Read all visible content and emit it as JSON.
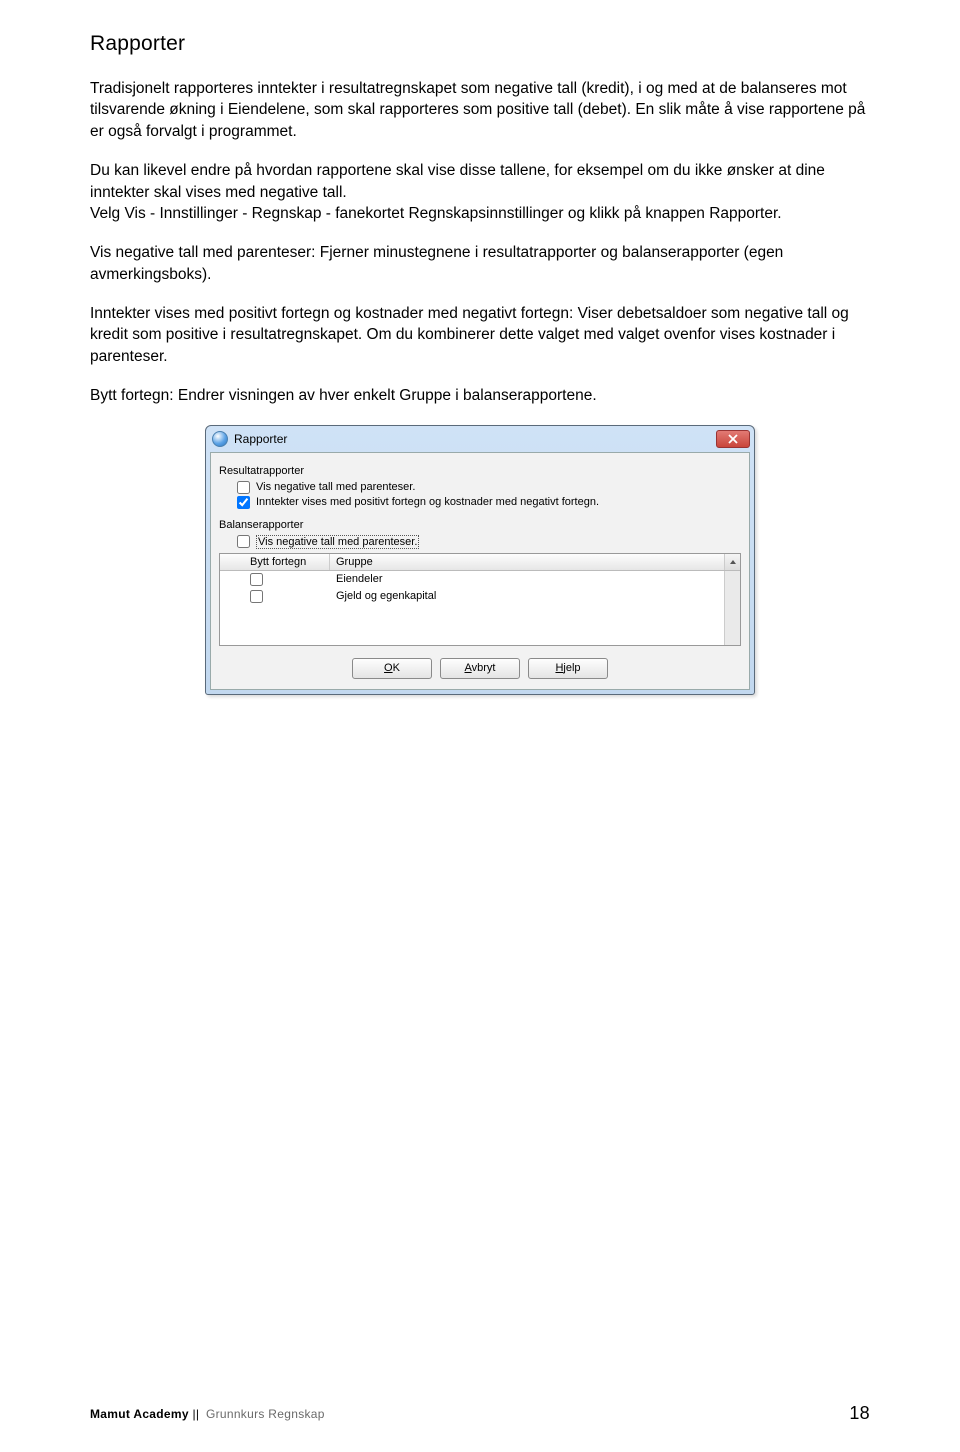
{
  "heading": "Rapporter",
  "paragraphs": {
    "p1": "Tradisjonelt rapporteres inntekter i resultatregnskapet som negative tall (kredit), i og med at de balanseres mot tilsvarende økning i Eiendelene, som skal rapporteres som positive tall (debet). En slik måte å vise rapportene på er også forvalgt i programmet.",
    "p2a": "Du kan likevel endre på hvordan rapportene skal vise disse tallene, for eksempel om du ikke ønsker at dine inntekter skal vises med negative tall.",
    "p2b": "Velg Vis - Innstillinger - Regnskap - fanekortet Regnskapsinnstillinger og klikk på knappen Rapporter.",
    "p3": "Vis negative tall med parenteser: Fjerner minustegnene i resultatrapporter og balanserapporter (egen avmerkingsboks).",
    "p4": "Inntekter vises med positivt fortegn og kostnader med negativt fortegn: Viser debetsaldoer som negative tall og kredit som positive i resultatregnskapet. Om du kombinerer dette valget med valget ovenfor vises kostnader i parenteser.",
    "p5": "Bytt fortegn: Endrer visningen av hver enkelt Gruppe i balanserapportene."
  },
  "dialog": {
    "title": "Rapporter",
    "group1": "Resultatrapporter",
    "check1": "Vis negative tall med parenteser.",
    "check2": "Inntekter vises med positivt fortegn og kostnader med negativt fortegn.",
    "group2": "Balanserapporter",
    "check3": "Vis negative tall med parenteser.",
    "table": {
      "col1": "Bytt fortegn",
      "col2": "Gruppe",
      "rows": [
        "Eiendeler",
        "Gjeld og egenkapital"
      ]
    },
    "buttons": {
      "ok": "OK",
      "cancel": "Avbryt",
      "help": "Hjelp"
    }
  },
  "footer": {
    "brand": "Mamut Academy",
    "sep": "||",
    "course": "Grunnkurs Regnskap",
    "page": "18"
  }
}
